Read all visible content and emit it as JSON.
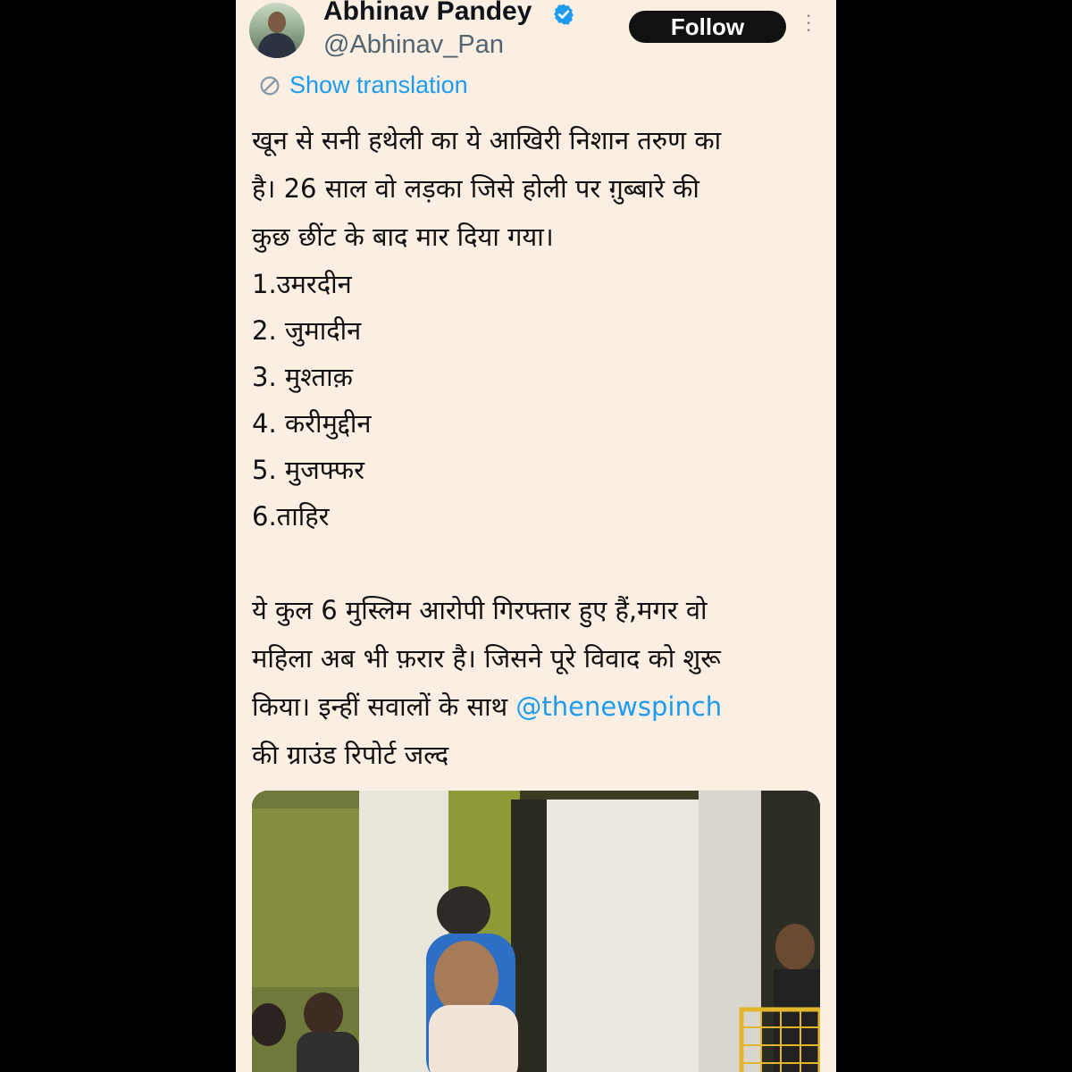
{
  "author": {
    "name": "Abhinav Pandey",
    "handle": "@Abhinav_Pan",
    "verified": true
  },
  "actions": {
    "follow_label": "Follow",
    "more_icon": "more-vertical-icon"
  },
  "translation": {
    "label": "Show translation",
    "icon": "translate-icon"
  },
  "tweet": {
    "intro_line1": "खून से सनी हथेली का ये आखिरी निशान तरुण का",
    "intro_line2": "है। 26 साल वो लड़का जिसे होली पर ग़ुब्बारे की",
    "intro_line3": "कुछ छींट के बाद मार दिया गया।",
    "accused": [
      "1.उमरदीन",
      "2. जुमादीन",
      "3. मुश्ताक़",
      "4. करीमुद्दीन",
      "5. मुजफ्फर",
      "6.ताहिर"
    ],
    "outro_line1": "ये कुल 6 मुस्लिम आरोपी गिरफ्तार हुए हैं,मगर वो",
    "outro_line2": "महिला अब भी फ़रार है। जिसने पूरे विवाद को शुरू",
    "outro_line3_prefix": "किया। इन्हीं सवालों के साथ ",
    "mention": "@thenewspinch",
    "outro_line4": "की ग्राउंड रिपोर्ट जल्द"
  },
  "colors": {
    "card_background": "#faefe2",
    "link": "#1d9bf0",
    "follow_button": "#111111",
    "verified_badge": "#1d9bf0"
  }
}
